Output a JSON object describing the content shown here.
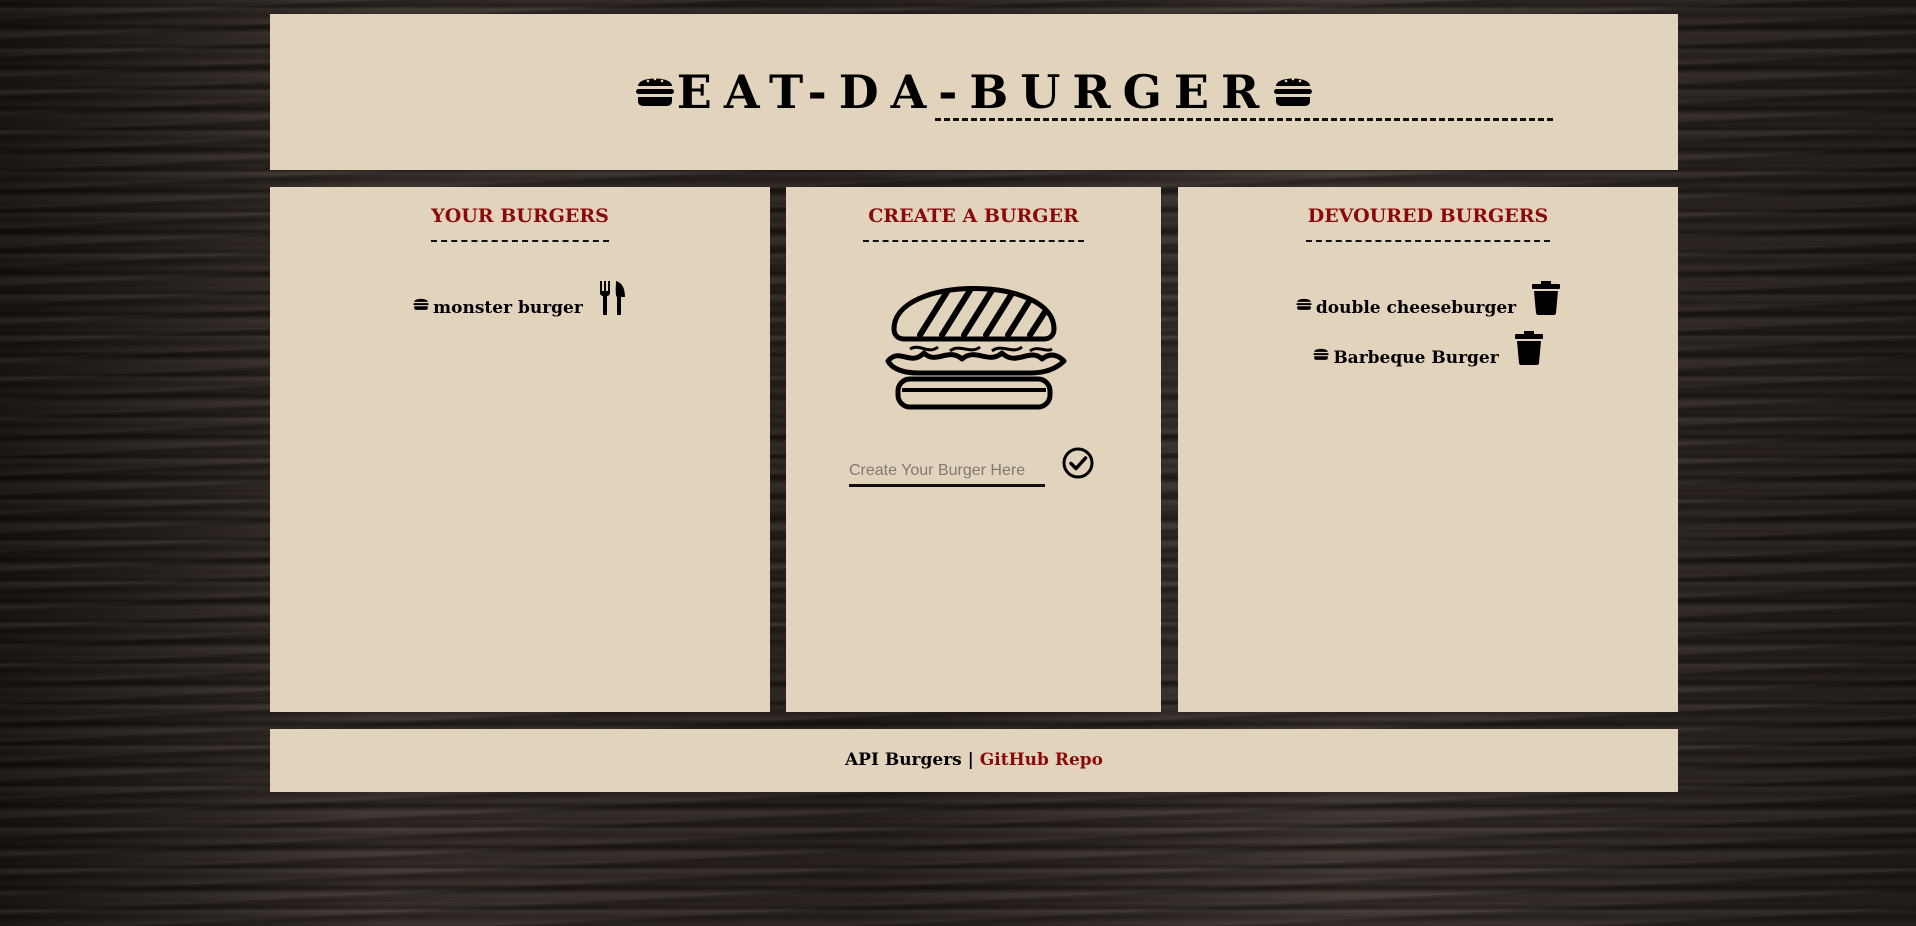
{
  "header": {
    "title": "EAT-DA-BURGER",
    "icon": "hamburger-icon"
  },
  "your_burgers": {
    "title": "YOUR BURGERS",
    "items": [
      {
        "name": "monster burger",
        "icon": "hamburger-icon",
        "action_icon": "utensils-icon"
      }
    ]
  },
  "create_burger": {
    "title": "CREATE A BURGER",
    "image_icon": "burger-illustration",
    "input_value": "",
    "input_placeholder": "Create Your Burger Here",
    "submit_icon": "check-circle-icon"
  },
  "devoured_burgers": {
    "title": "DEVOURED BURGERS",
    "items": [
      {
        "name": "double cheeseburger",
        "icon": "hamburger-icon",
        "action_icon": "trash-icon"
      },
      {
        "name": "Barbeque Burger",
        "icon": "hamburger-icon",
        "action_icon": "trash-icon"
      }
    ]
  },
  "footer": {
    "text": "API Burgers |",
    "link_label": "GitHub Repo"
  },
  "colors": {
    "panel": "#e2d3bd",
    "accent": "#8a0a0a",
    "text": "#000000"
  }
}
